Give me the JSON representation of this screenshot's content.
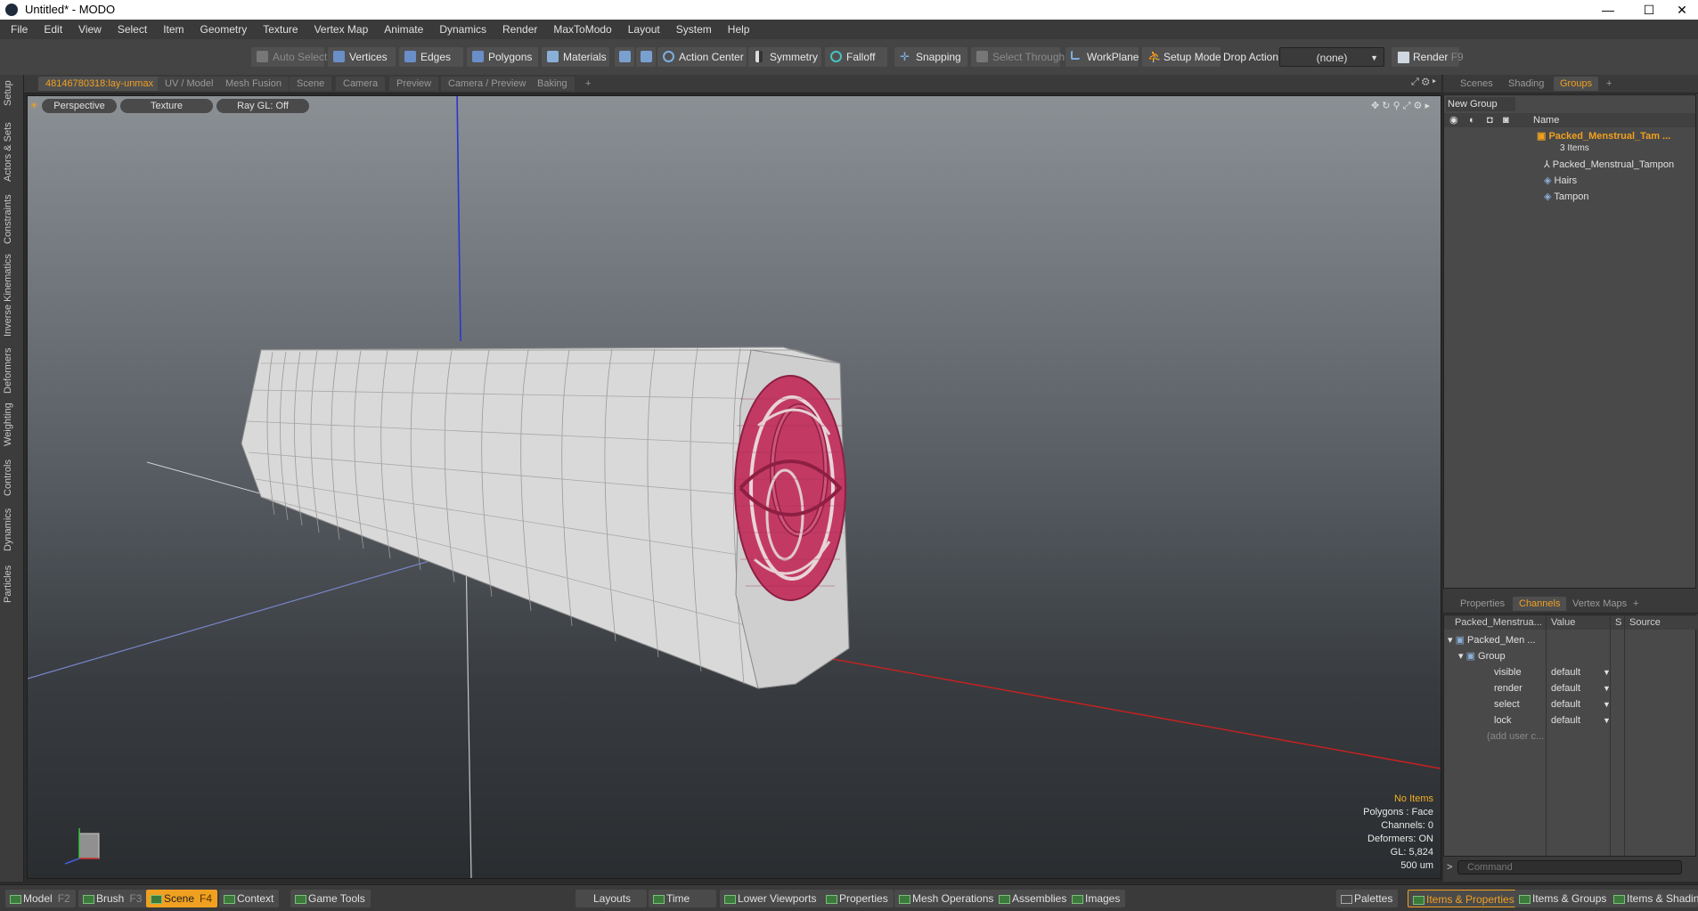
{
  "window": {
    "title": "Untitled* - MODO",
    "minimize": "—",
    "maximize": "☐",
    "close": "✕"
  },
  "menu": [
    "File",
    "Edit",
    "View",
    "Select",
    "Item",
    "Geometry",
    "Texture",
    "Vertex Map",
    "Animate",
    "Dynamics",
    "Render",
    "MaxToModo",
    "Layout",
    "System",
    "Help"
  ],
  "toolbar": {
    "auto_select": "Auto Select",
    "vertices": "Vertices",
    "edges": "Edges",
    "polygons": "Polygons",
    "materials": "Materials",
    "action_center": "Action Center",
    "symmetry": "Symmetry",
    "falloff": "Falloff",
    "snapping": "Snapping",
    "select_through": "Select Through",
    "workplane": "WorkPlane",
    "setup_mode": "Setup Mode",
    "drop_action": "Drop Action",
    "drop_value": "(none)",
    "render": "Render",
    "render_key": "F9"
  },
  "left_tabs": [
    "Setup",
    "Actors & Sets",
    "Constraints",
    "Inverse Kinematics",
    "Deformers",
    "Weighting",
    "Controls",
    "Dynamics",
    "Particles"
  ],
  "viewport_tabs": [
    "48146780318:lay-unmax",
    "UV / Model",
    "Mesh Fusion",
    "Scene",
    "Camera",
    "Preview",
    "Camera / Preview",
    "Baking",
    "+"
  ],
  "viewport": {
    "perspective": "Perspective",
    "texture": "Texture",
    "raygl": "Ray GL: Off",
    "info": {
      "items": "No Items",
      "polygons": "Polygons : Face",
      "channels": "Channels: 0",
      "deformers": "Deformers: ON",
      "gl": "GL: 5,824",
      "size": "500 um"
    }
  },
  "right_top_tabs": [
    "Scenes",
    "Shading",
    "Groups",
    "+"
  ],
  "groups": {
    "new_group": "New Group",
    "col_name": "Name",
    "root": "Packed_Menstrual_Tam ...",
    "root_count": "3 Items",
    "children": [
      "Packed_Menstrual_Tampon",
      "Hairs",
      "Tampon"
    ]
  },
  "right_bottom_tabs": [
    "Properties",
    "Channels",
    "Vertex Maps",
    "+"
  ],
  "channels": {
    "col_item": "Packed_Menstrua...",
    "col_value": "Value",
    "col_s": "S",
    "col_source": "Source",
    "item": "Packed_Men ...",
    "group": "Group",
    "rows": [
      {
        "name": "visible",
        "value": "default"
      },
      {
        "name": "render",
        "value": "default"
      },
      {
        "name": "select",
        "value": "default"
      },
      {
        "name": "lock",
        "value": "default"
      }
    ],
    "add_user": "(add user c..."
  },
  "command": {
    "placeholder": "Command",
    "prompt": ">"
  },
  "bottom": {
    "model": "Model",
    "model_key": "F2",
    "brush": "Brush",
    "brush_key": "F3",
    "scene": "Scene",
    "scene_key": "F4",
    "context": "Context",
    "game_tools": "Game Tools",
    "layouts": "Layouts",
    "time": "Time",
    "lower_viewports": "Lower Viewports",
    "properties": "Properties",
    "mesh_operations": "Mesh Operations",
    "assemblies": "Assemblies",
    "images": "Images",
    "palettes": "Palettes",
    "items_properties": "Items & Properties",
    "items_groups": "Items & Groups",
    "items_shading": "Items & Shading"
  },
  "colors": {
    "accent": "#f0a020",
    "hairs": "#c23a63",
    "mesh": "#d6d6d6",
    "axis_x": "#cc2020",
    "axis_y": "#2030d0"
  }
}
